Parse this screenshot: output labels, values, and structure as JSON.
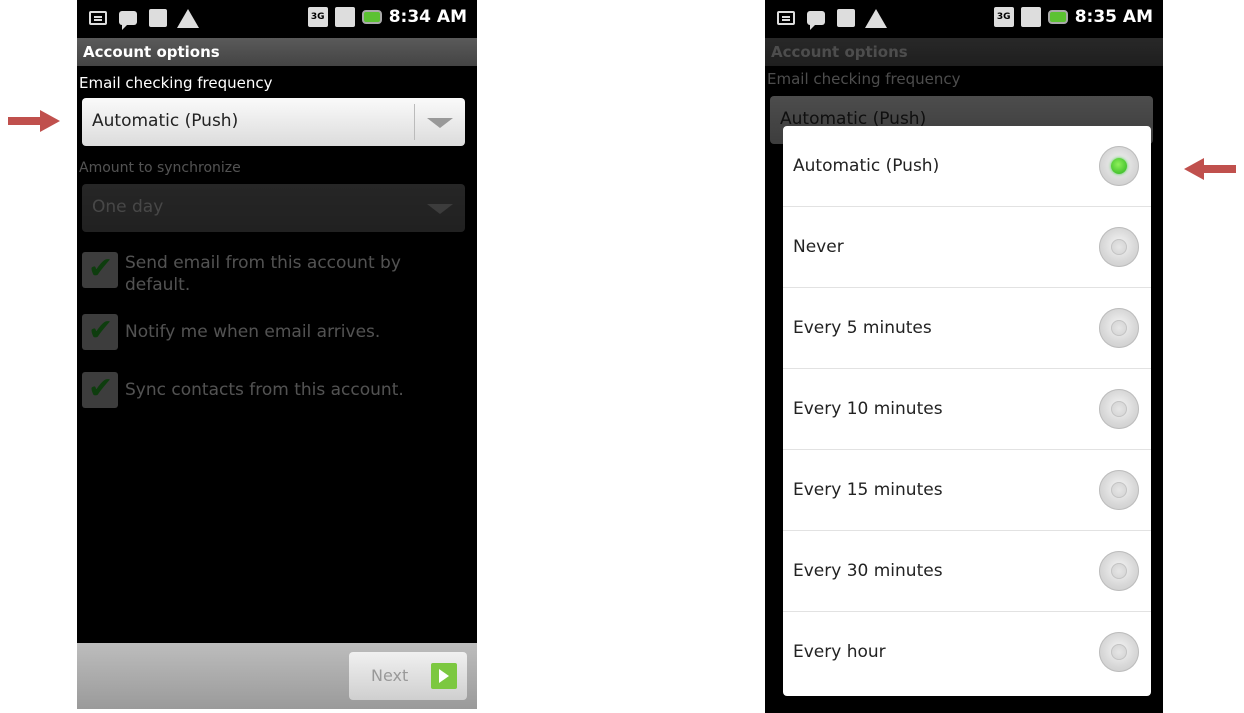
{
  "left_screen": {
    "status_time": "8:34 AM",
    "title": "Account options",
    "frequency_label": "Email checking frequency",
    "frequency_value": "Automatic (Push)",
    "sync_label": "Amount to synchronize",
    "sync_value": "One day",
    "checkboxes": [
      {
        "label": "Send email from this account by default.",
        "checked": true
      },
      {
        "label": "Notify me when email arrives.",
        "checked": true
      },
      {
        "label": "Sync contacts from this account.",
        "checked": true
      }
    ],
    "next_label": "Next"
  },
  "right_screen": {
    "status_time": "8:35 AM",
    "background_title": "Account options",
    "background_frequency_label": "Email checking frequency",
    "background_frequency_value": "Automatic (Push)",
    "options": [
      {
        "label": "Automatic (Push)",
        "selected": true
      },
      {
        "label": "Never",
        "selected": false
      },
      {
        "label": "Every 5 minutes",
        "selected": false
      },
      {
        "label": "Every 10 minutes",
        "selected": false
      },
      {
        "label": "Every 15 minutes",
        "selected": false
      },
      {
        "label": "Every 30 minutes",
        "selected": false
      },
      {
        "label": "Every hour",
        "selected": false
      }
    ]
  },
  "status_icons": [
    "keyboard-icon",
    "message-icon",
    "usb-icon",
    "warning-icon",
    "3g-icon",
    "signal-icon",
    "battery-icon"
  ],
  "colors": {
    "annotation_arrow": "#c0504d",
    "radio_selected": "#2ab21e",
    "checkbox_check": "#2ebd2e"
  }
}
